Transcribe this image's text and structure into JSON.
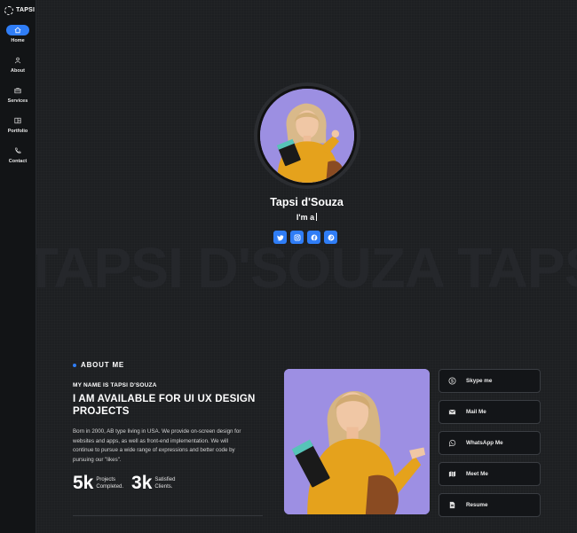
{
  "brand": {
    "name": "TAPSI"
  },
  "nav": [
    {
      "label": "Home",
      "icon": "home-icon",
      "active": true
    },
    {
      "label": "About",
      "icon": "user-icon"
    },
    {
      "label": "Services",
      "icon": "briefcase-icon"
    },
    {
      "label": "Portfolio",
      "icon": "portfolio-icon"
    },
    {
      "label": "Contact",
      "icon": "phone-icon"
    }
  ],
  "hero": {
    "name": "Tapsi d'Souza",
    "role_prefix": "I'm a",
    "watermark": "TAPSI D'SOUZA TAPSI D'SOUZA",
    "socials": [
      "twitter-icon",
      "instagram-icon",
      "facebook-icon",
      "pinterest-icon"
    ]
  },
  "about": {
    "tag": "ABOUT ME",
    "my_name": "MY NAME IS TAPSI D'SOUZA",
    "headline": "I AM AVAILABLE FOR UI UX DESIGN PROJECTS",
    "bio": "Born in 2000, AB type living in USA. We provide on-screen design for websites and apps, as well as front-end implementation. We will continue to pursue a wide range of expressions and better code by pursuing our \"likes\".",
    "stats": [
      {
        "num": "5k",
        "label1": "Projects",
        "label2": "Completed."
      },
      {
        "num": "3k",
        "label1": "Satisfied",
        "label2": "Clients."
      }
    ]
  },
  "contacts": [
    {
      "label": "Skype me",
      "icon": "skype-icon"
    },
    {
      "label": "Mail Me",
      "icon": "mail-icon"
    },
    {
      "label": "WhatsApp Me",
      "icon": "whatsapp-icon"
    },
    {
      "label": "Meet Me",
      "icon": "map-icon"
    },
    {
      "label": "Resume",
      "icon": "file-icon"
    }
  ],
  "colors": {
    "accent": "#2f7df6",
    "bg": "#1d1f22",
    "sidebar": "#121416",
    "photo_bg": "#9d8fe3",
    "sweater": "#e5a21c"
  }
}
